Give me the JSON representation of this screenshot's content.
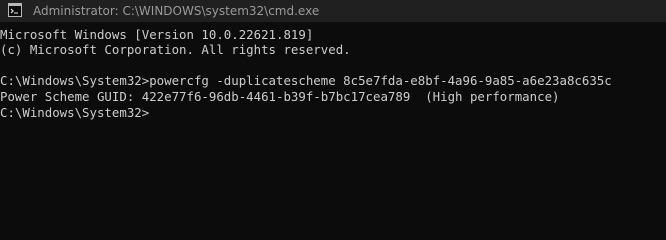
{
  "window": {
    "title": "Administrator: C:\\WINDOWS\\system32\\cmd.exe",
    "icon": "cmd-icon"
  },
  "console": {
    "lines": [
      "Microsoft Windows [Version 10.0.22621.819]",
      "(c) Microsoft Corporation. All rights reserved.",
      "",
      "C:\\Windows\\System32>powercfg -duplicatescheme 8c5e7fda-e8bf-4a96-9a85-a6e23a8c635c",
      "Power Scheme GUID: 422e77f6-96db-4461-b39f-b7bc17cea789  (High performance)",
      "C:\\Windows\\System32>"
    ]
  },
  "colors": {
    "background": "#0c0c0c",
    "titlebar": "#202020",
    "text": "#cccccc",
    "title_text": "#9a9a9a"
  }
}
